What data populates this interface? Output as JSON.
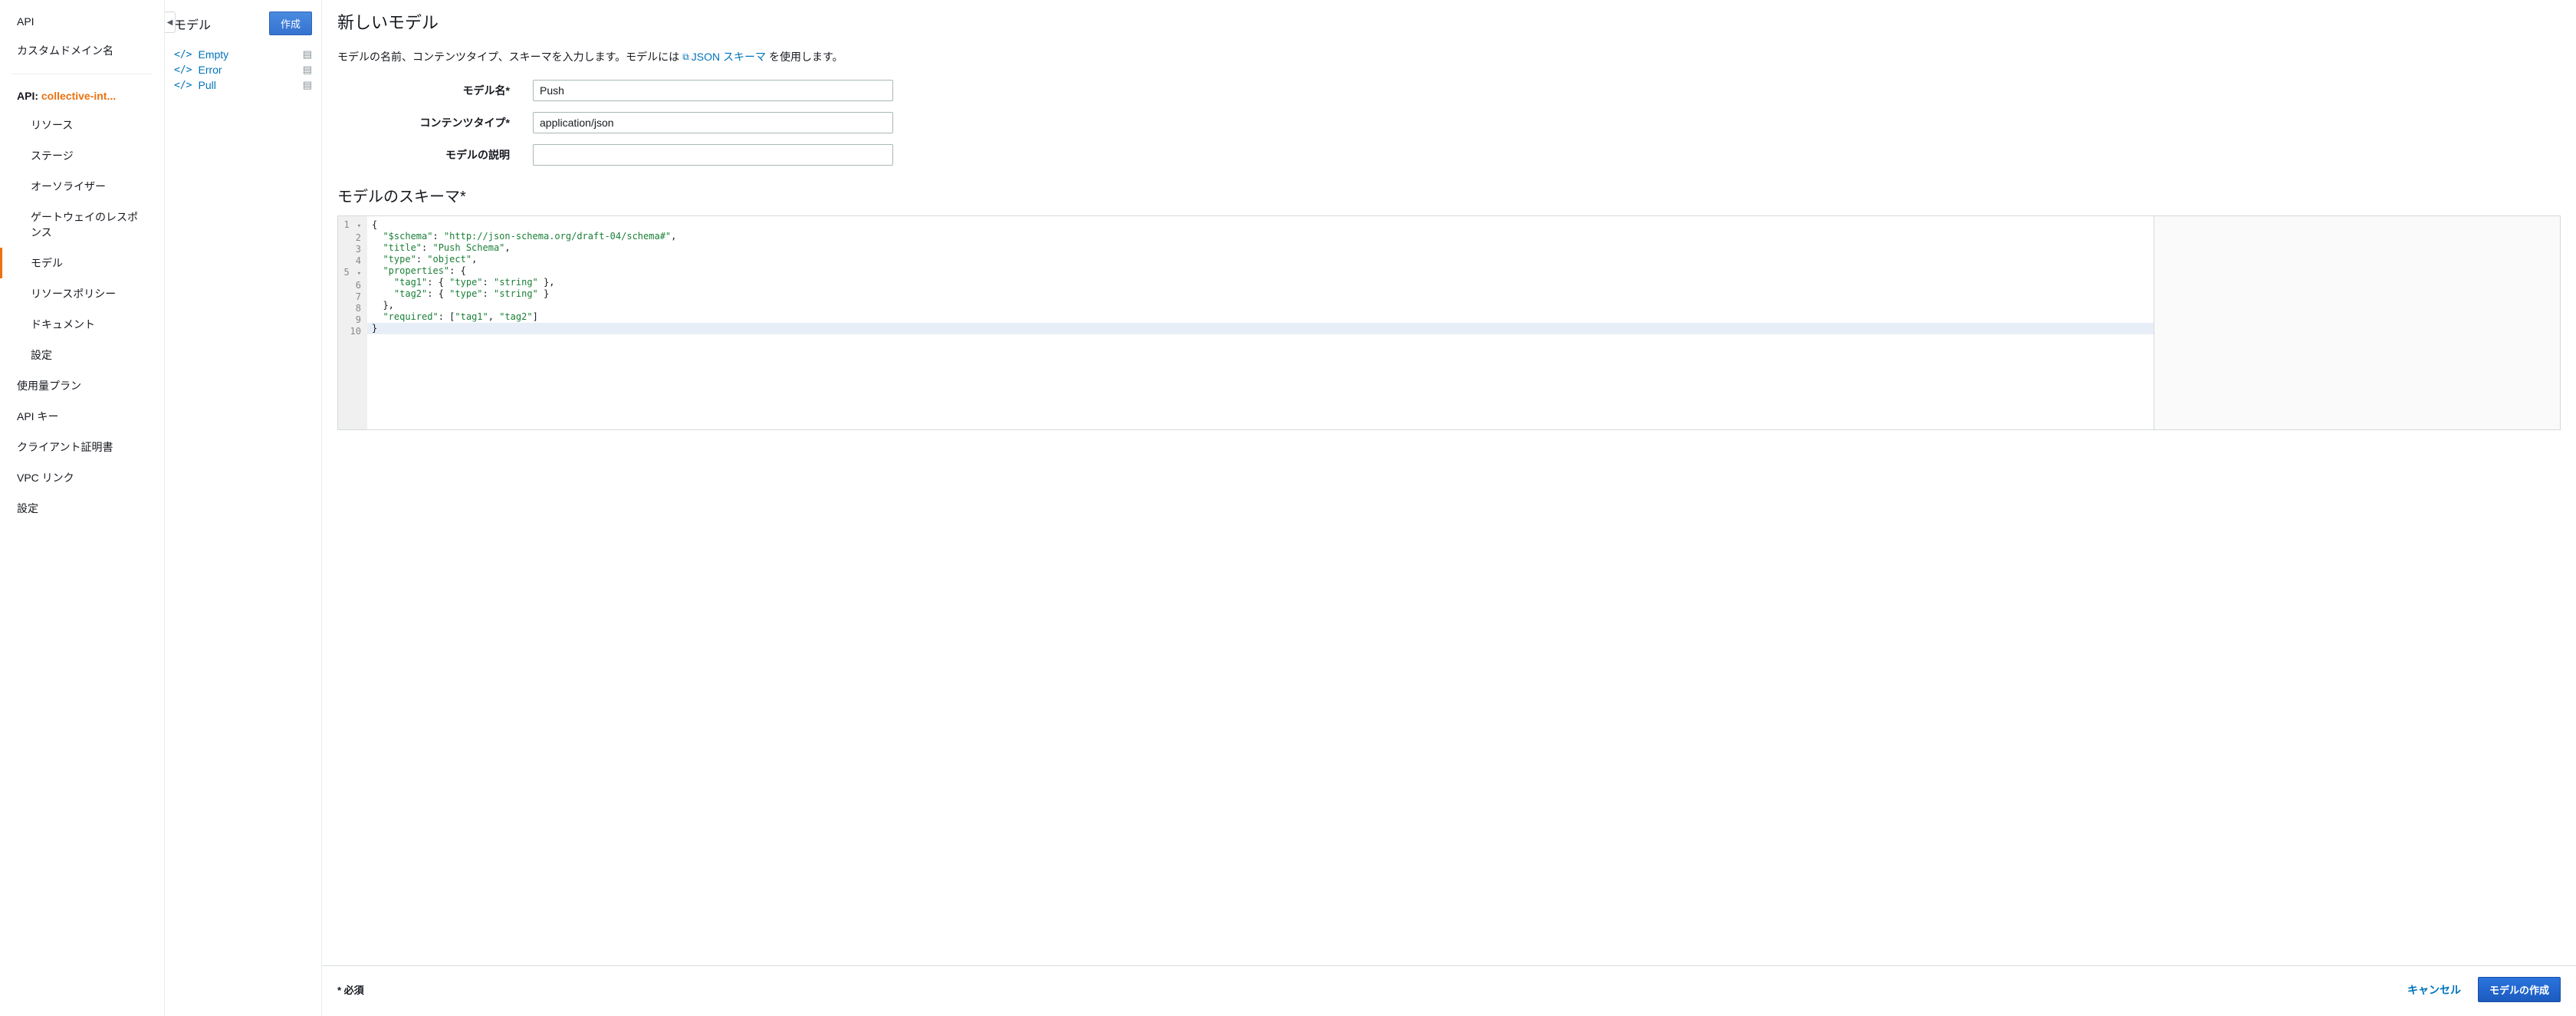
{
  "sidebar_primary": {
    "items_top": [
      "API",
      "カスタムドメイン名"
    ],
    "api_label": "API:",
    "api_name": "collective-int...",
    "items_api": [
      "リソース",
      "ステージ",
      "オーソライザー",
      "ゲートウェイのレスポンス",
      "モデル",
      "リソースポリシー",
      "ドキュメント",
      "設定"
    ],
    "active_api_index": 4,
    "items_bottom": [
      "使用量プラン",
      "API キー",
      "クライアント証明書",
      "VPC リンク",
      "設定"
    ]
  },
  "sidebar_secondary": {
    "title": "モデル",
    "create_button": "作成",
    "models": [
      "Empty",
      "Error",
      "Pull"
    ]
  },
  "main": {
    "title": "新しいモデル",
    "desc_pre": "モデルの名前、コンテンツタイプ、スキーマを入力します。モデルには",
    "desc_link": "JSON スキーマ",
    "desc_post": "を使用します。",
    "form": {
      "name_label": "モデル名*",
      "name_value": "Push",
      "ctype_label": "コンテンツタイプ*",
      "ctype_value": "application/json",
      "desc_label": "モデルの説明",
      "desc_value": ""
    },
    "schema_title": "モデルのスキーマ*",
    "schema_lines": [
      {
        "n": "1",
        "fold": true,
        "raw": "{"
      },
      {
        "n": "2",
        "raw": "  \"$schema\": \"http://json-schema.org/draft-04/schema#\","
      },
      {
        "n": "3",
        "raw": "  \"title\": \"Push Schema\","
      },
      {
        "n": "4",
        "raw": "  \"type\": \"object\","
      },
      {
        "n": "5",
        "fold": true,
        "raw": "  \"properties\": {"
      },
      {
        "n": "6",
        "raw": "    \"tag1\": { \"type\": \"string\" },"
      },
      {
        "n": "7",
        "raw": "    \"tag2\": { \"type\": \"string\" }"
      },
      {
        "n": "8",
        "raw": "  },"
      },
      {
        "n": "9",
        "raw": "  \"required\": [\"tag1\", \"tag2\"]"
      },
      {
        "n": "10",
        "active": true,
        "raw": "}"
      }
    ],
    "footer": {
      "required": "* 必須",
      "cancel": "キャンセル",
      "submit": "モデルの作成"
    }
  }
}
